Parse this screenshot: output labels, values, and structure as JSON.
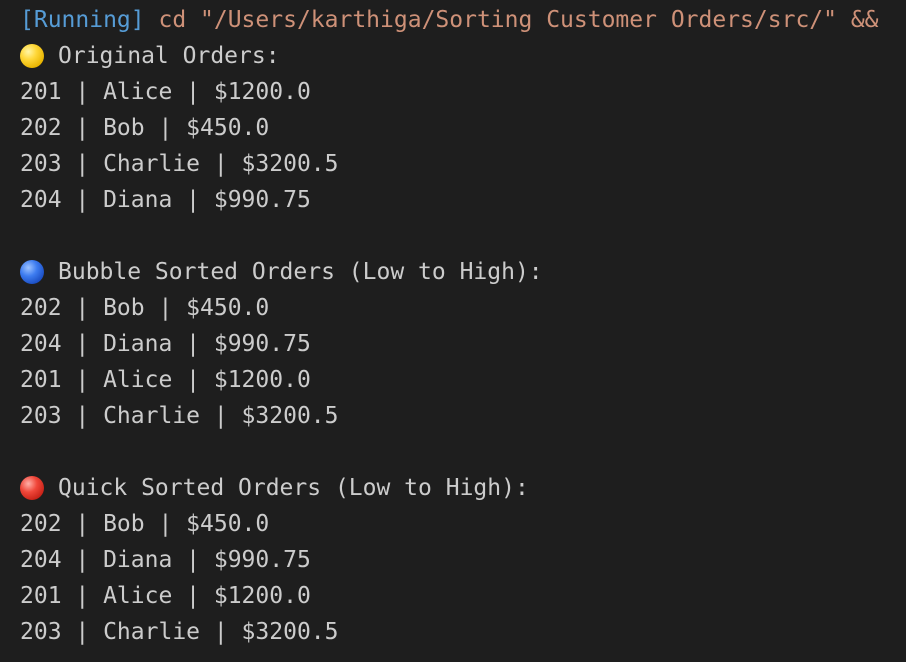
{
  "terminal": {
    "command": {
      "status": "[Running]",
      "text": " cd \"/Users/karthiga/Sorting Customer Orders/src/\" &&"
    },
    "sections": [
      {
        "icon": "yellow-circle-icon",
        "heading": "Original Orders:",
        "rows": [
          "201 | Alice | $1200.0",
          "202 | Bob | $450.0",
          "203 | Charlie | $3200.5",
          "204 | Diana | $990.75"
        ]
      },
      {
        "icon": "blue-circle-icon",
        "heading": "Bubble Sorted Orders (Low to High):",
        "rows": [
          "202 | Bob | $450.0",
          "204 | Diana | $990.75",
          "201 | Alice | $1200.0",
          "203 | Charlie | $3200.5"
        ]
      },
      {
        "icon": "red-circle-icon",
        "heading": "Quick Sorted Orders (Low to High):",
        "rows": [
          "202 | Bob | $450.0",
          "204 | Diana | $990.75",
          "201 | Alice | $1200.0",
          "203 | Charlie | $3200.5"
        ]
      }
    ]
  },
  "colors": {
    "background": "#1e1e1e",
    "text": "#cccccc",
    "running_tag": "#569cd6",
    "command": "#ce9178"
  }
}
